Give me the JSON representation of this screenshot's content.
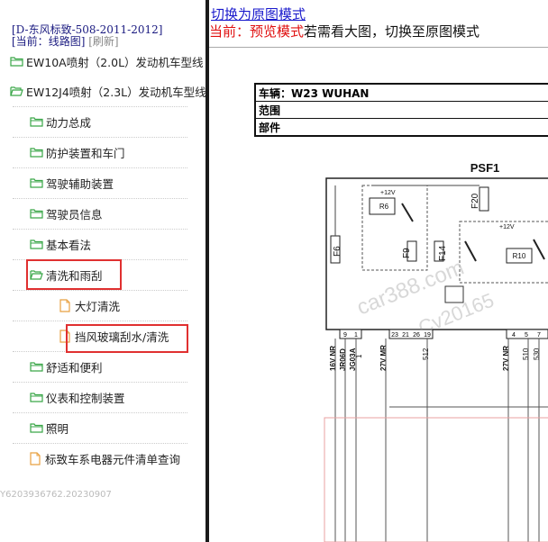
{
  "left_panel": {
    "header_title": "[D-东风标致-508-2011-2012]",
    "current_prefix": "[当前：",
    "current_value": "线路图",
    "current_suffix": "]",
    "refresh_label": "[刷新]",
    "tree": [
      {
        "label": "EW10A喷射（2.0L）发动机车型线",
        "icon": "folder-closed",
        "level": 0
      },
      {
        "label": "EW12J4喷射（2.3L）发动机车型线",
        "icon": "folder-open",
        "level": 0
      },
      {
        "label": "动力总成",
        "icon": "folder-closed",
        "level": 1
      },
      {
        "label": "防护装置和车门",
        "icon": "folder-closed",
        "level": 1
      },
      {
        "label": "驾驶辅助装置",
        "icon": "folder-closed",
        "level": 1
      },
      {
        "label": "驾驶员信息",
        "icon": "folder-closed",
        "level": 1
      },
      {
        "label": "基本看法",
        "icon": "folder-closed",
        "level": 1
      },
      {
        "label": "清洗和雨刮",
        "icon": "folder-open",
        "level": 1
      },
      {
        "label": "大灯清洗",
        "icon": "document",
        "level": 2
      },
      {
        "label": "挡风玻璃刮水/清洗",
        "icon": "document",
        "level": 2
      },
      {
        "label": "舒适和便利",
        "icon": "folder-closed",
        "level": 1
      },
      {
        "label": "仪表和控制装置",
        "icon": "folder-closed",
        "level": 1
      },
      {
        "label": "照明",
        "icon": "folder-closed",
        "level": 1
      },
      {
        "label": "标致车系电器元件清单查询",
        "icon": "document",
        "level": 1
      }
    ],
    "bottom_id": "Y6203936762.20230907"
  },
  "right_panel": {
    "switch_link": "切换为原图模式",
    "mode_current": "当前：预览模式",
    "mode_tip": "若需看大图，切换至原图模式",
    "table_rows": [
      "车辆：W23 WUHAN",
      "范围",
      "部件"
    ],
    "diagram": {
      "title": "PSF1",
      "fuses": [
        "F6",
        "F9",
        "F14",
        "F20"
      ],
      "relays": [
        "R6",
        "R10"
      ],
      "voltage": "+12V",
      "watermark1": "car388.com",
      "watermark2": "Cv20165",
      "pins_left": [
        "9",
        "1"
      ],
      "pins_mid": [
        "23",
        "21",
        "26",
        "19"
      ],
      "pins_right": [
        "4",
        "5",
        "7"
      ],
      "wires": [
        "16V NR",
        "JR06D",
        "JG03A",
        "27V MR",
        "512",
        "27V NR",
        "510",
        "530"
      ],
      "wire_nums": [
        "1"
      ]
    }
  },
  "colors": {
    "link": "#1a1acc",
    "current_mode": "#e01010",
    "highlight": "#e03030",
    "divider": "#1a1a1a"
  }
}
